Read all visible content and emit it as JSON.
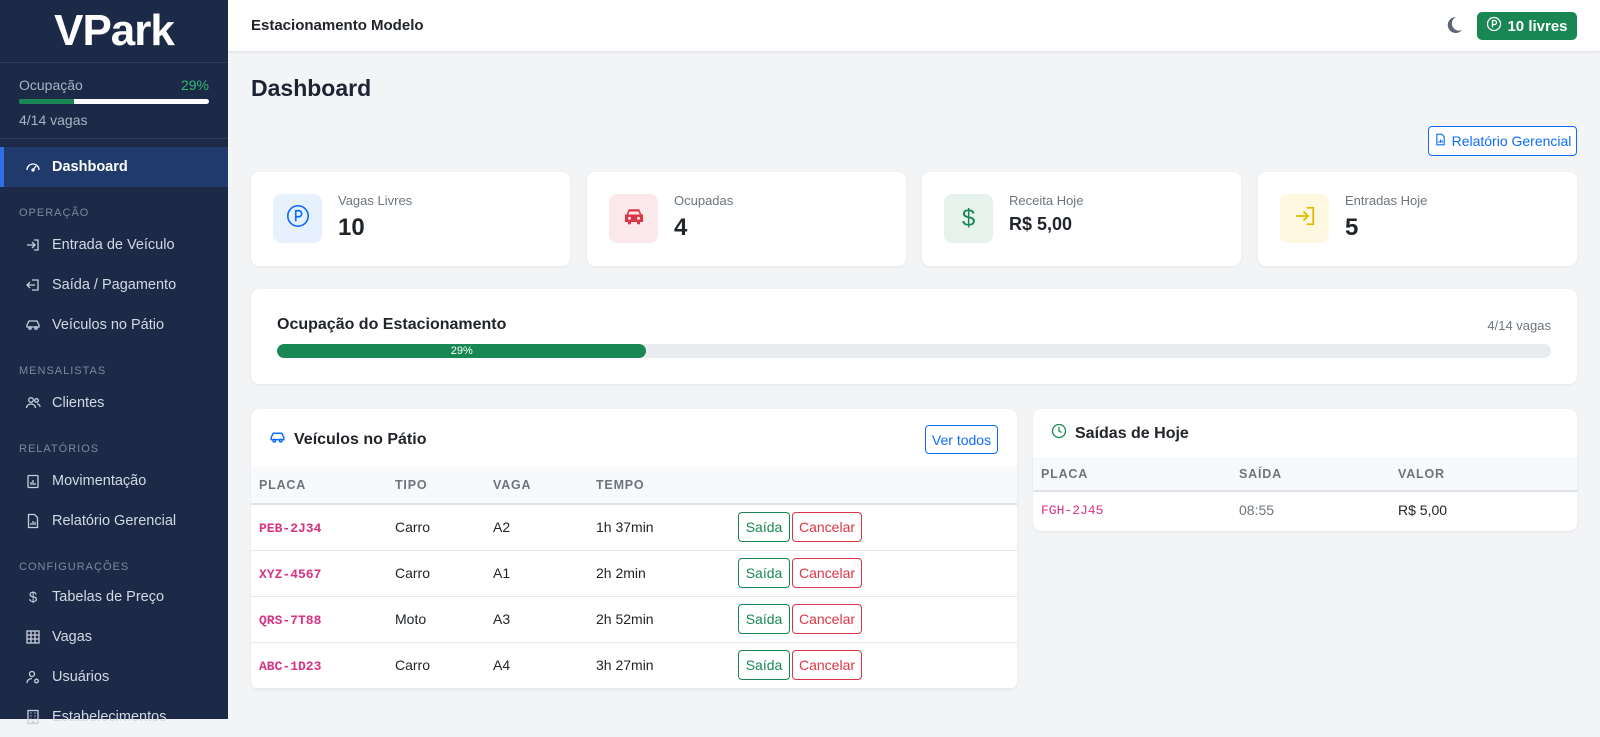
{
  "sidebar": {
    "brand": "VPark",
    "occupancy": {
      "label": "Ocupação",
      "percent_text": "29%",
      "fraction": 0.29,
      "sub": "4/14 vagas"
    },
    "items": [
      {
        "label": "Dashboard",
        "icon": "speedometer-icon",
        "active": true
      },
      {
        "section": "OPERAÇÃO"
      },
      {
        "label": "Entrada de Veículo",
        "icon": "box-arrow-in-icon"
      },
      {
        "label": "Saída / Pagamento",
        "icon": "box-arrow-left-icon"
      },
      {
        "label": "Veículos no Pátio",
        "icon": "car-icon"
      },
      {
        "section": "MENSALISTAS"
      },
      {
        "label": "Clientes",
        "icon": "people-icon"
      },
      {
        "section": "RELATÓRIOS"
      },
      {
        "label": "Movimentação",
        "icon": "clipboard-data-icon"
      },
      {
        "label": "Relatório Gerencial",
        "icon": "file-bar-chart-icon"
      },
      {
        "section": "CONFIGURAÇÕES"
      },
      {
        "label": "Tabelas de Preço",
        "icon": "dollar-icon"
      },
      {
        "label": "Vagas",
        "icon": "grid-icon"
      },
      {
        "label": "Usuários",
        "icon": "person-gear-icon"
      },
      {
        "label": "Estabelecimentos",
        "icon": "building-icon"
      }
    ]
  },
  "topbar": {
    "establishment": "Estacionamento Modelo",
    "free_badge": "10 livres"
  },
  "main": {
    "title": "Dashboard",
    "report_button": "Relatório Gerencial",
    "stats": [
      {
        "label": "Vagas Livres",
        "value": "10",
        "icon": "parking-icon",
        "bg": "#e7f0fd",
        "color": "#0d6efd"
      },
      {
        "label": "Ocupadas",
        "value": "4",
        "icon": "car-front-icon",
        "bg": "#fbe8ea",
        "color": "#dc3545"
      },
      {
        "label": "Receita Hoje",
        "value": "R$ 5,00",
        "icon": "currency-dollar-icon",
        "bg": "#e6f3ec",
        "color": "#198754"
      },
      {
        "label": "Entradas Hoje",
        "value": "5",
        "icon": "box-arrow-in-right-icon",
        "bg": "#fff8e1",
        "color": "#e6b800"
      }
    ],
    "occupancy_card": {
      "title": "Ocupação do Estacionamento",
      "count": "4/14 vagas",
      "percent_text": "29%",
      "fraction": 0.29
    },
    "vehicles_panel": {
      "title": "Veículos no Pátio",
      "view_all": "Ver todos",
      "columns": [
        "PLACA",
        "TIPO",
        "VAGA",
        "TEMPO"
      ],
      "exit_label": "Saída",
      "cancel_label": "Cancelar",
      "rows": [
        {
          "plate": "PEB-2J34",
          "type": "Carro",
          "spot": "A2",
          "time": "1h 37min"
        },
        {
          "plate": "XYZ-4567",
          "type": "Carro",
          "spot": "A1",
          "time": "2h 2min"
        },
        {
          "plate": "QRS-7T88",
          "type": "Moto",
          "spot": "A3",
          "time": "2h 52min"
        },
        {
          "plate": "ABC-1D23",
          "type": "Carro",
          "spot": "A4",
          "time": "3h 27min"
        }
      ]
    },
    "exits_panel": {
      "title": "Saídas de Hoje",
      "columns": [
        "PLACA",
        "SAÍDA",
        "VALOR"
      ],
      "rows": [
        {
          "plate": "FGH-2J45",
          "exit": "08:55",
          "value": "R$ 5,00"
        }
      ]
    }
  }
}
